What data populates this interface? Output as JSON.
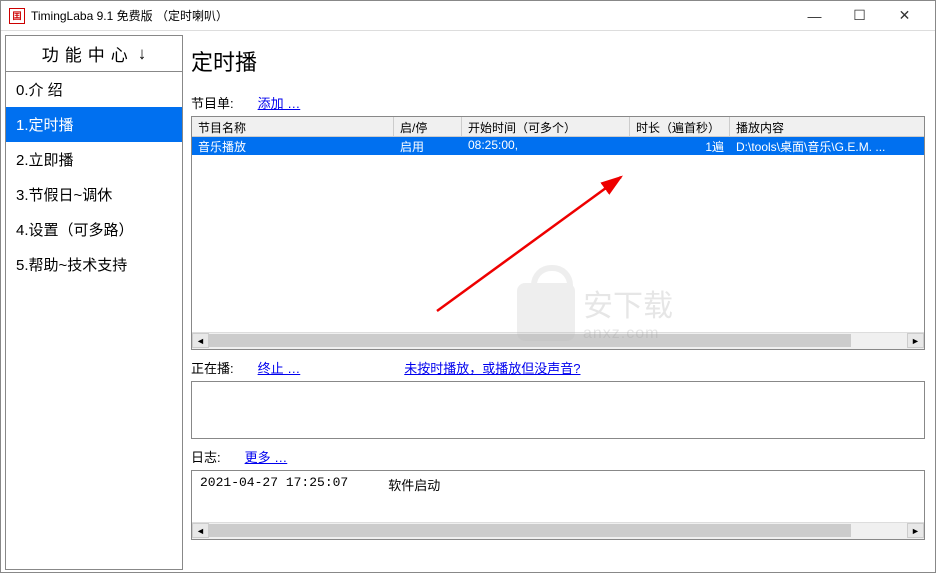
{
  "window": {
    "title": "TimingLaba 9.1 免费版 （定时喇叭）"
  },
  "sidebar": {
    "header": "功能中心",
    "arrow": "↓",
    "items": [
      {
        "label": "0.介 绍"
      },
      {
        "label": "1.定时播"
      },
      {
        "label": "2.立即播"
      },
      {
        "label": "3.节假日~调休"
      },
      {
        "label": "4.设置（可多路）"
      },
      {
        "label": "5.帮助~技术支持"
      }
    ],
    "selected_index": 1
  },
  "page": {
    "title": "定时播",
    "schedule_label": "节目单:",
    "add_link": "添加 …",
    "table": {
      "headers": {
        "name": "节目名称",
        "enable": "启/停",
        "start": "开始时间（可多个）",
        "duration": "时长（遍首秒）",
        "content": "播放内容"
      },
      "rows": [
        {
          "name": "音乐播放",
          "enable": "启用",
          "start": "08:25:00,",
          "duration": "1遍",
          "content": "D:\\tools\\桌面\\音乐\\G.E.M. ..."
        }
      ]
    },
    "now_playing_label": "正在播:",
    "stop_link": "终止 …",
    "help_link": "未按时播放，或播放但没声音?",
    "log_label": "日志:",
    "more_link": "更多 …",
    "log": {
      "time": "2021-04-27 17:25:07",
      "msg": "软件启动"
    }
  },
  "watermark": {
    "name": "安下载",
    "domain": "anxz.com"
  }
}
